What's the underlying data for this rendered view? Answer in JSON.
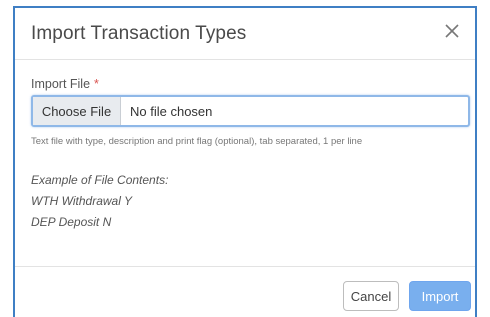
{
  "dialog": {
    "title": "Import Transaction Types",
    "close_icon": "close-icon"
  },
  "file_field": {
    "label": "Import File",
    "required_mark": "*",
    "choose_button": "Choose File",
    "status": "No file chosen",
    "help_text": "Text file with type, description and print flag (optional), tab separated, 1 per line"
  },
  "example": {
    "heading": "Example of File Contents:",
    "lines": [
      "WTH Withdrawal Y",
      "DEP Deposit N"
    ]
  },
  "footer": {
    "cancel_label": "Cancel",
    "import_label": "Import"
  },
  "colors": {
    "frame_border": "#3f7fc4",
    "primary_button": "#79afee",
    "required": "#d9534f"
  }
}
